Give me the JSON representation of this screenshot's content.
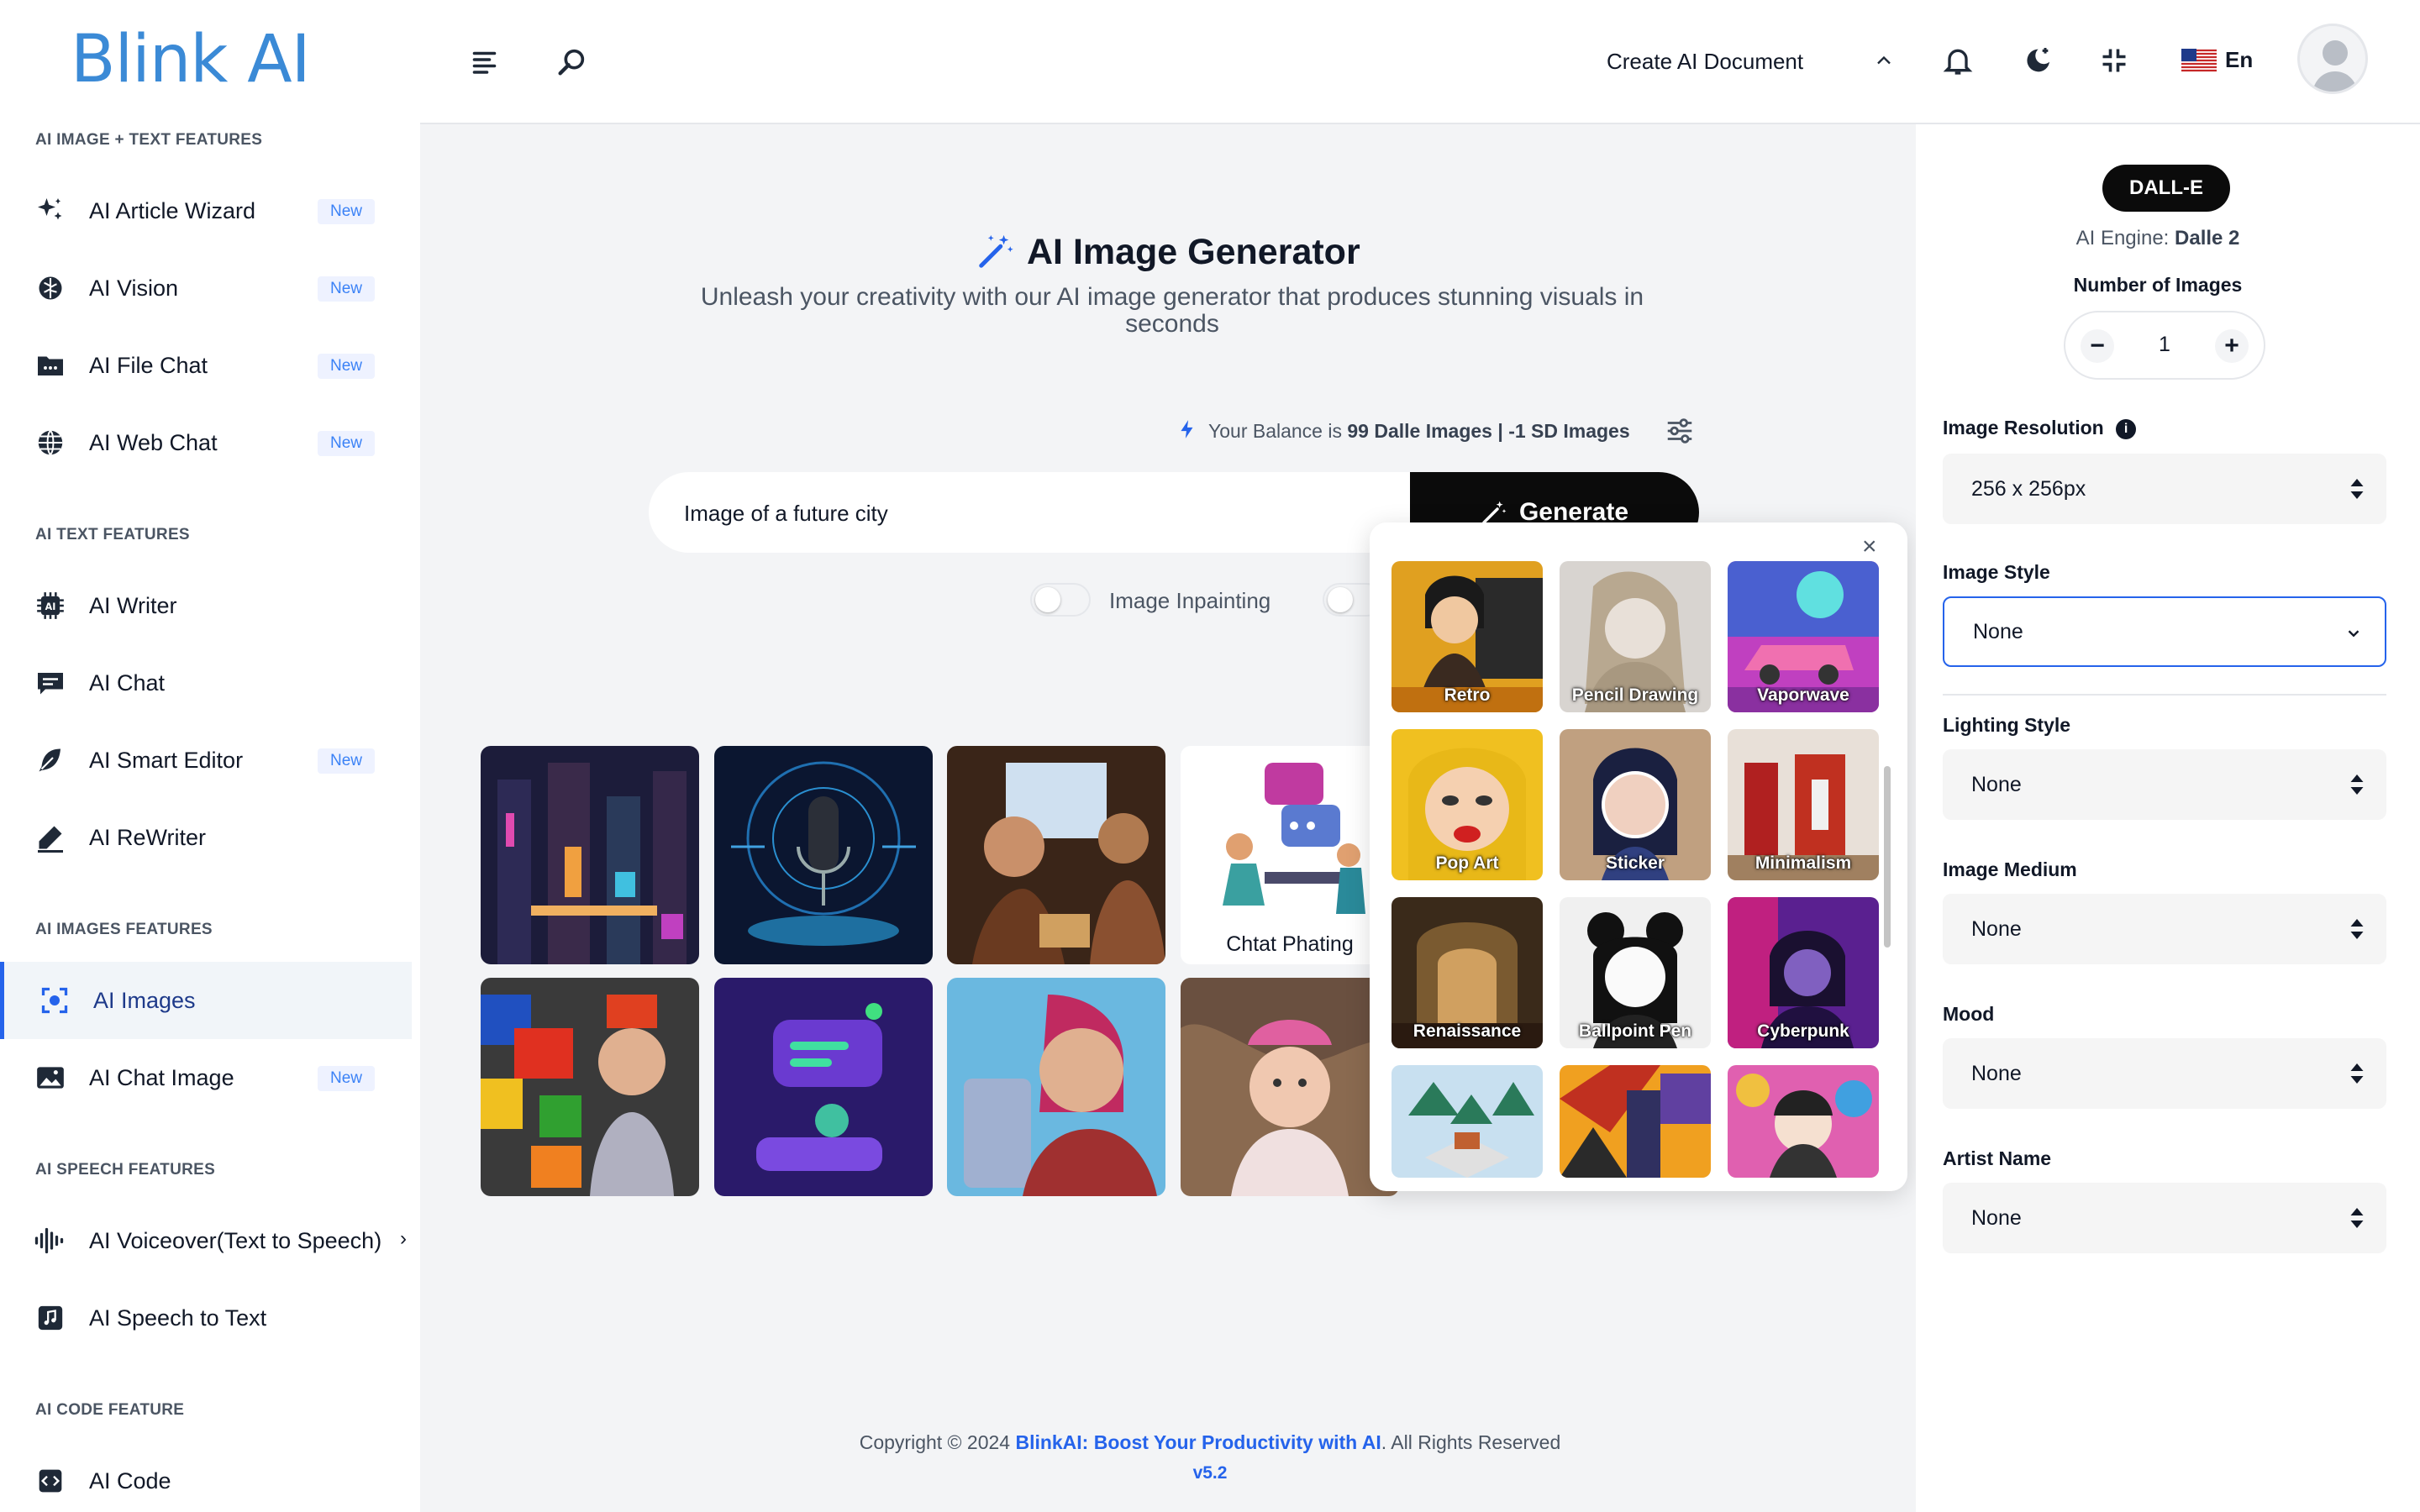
{
  "brand": {
    "logo": "Blink AI"
  },
  "sidebar": {
    "sections": [
      "AI IMAGE + TEXT FEATURES",
      "AI TEXT FEATURES",
      "AI IMAGES FEATURES",
      "AI SPEECH FEATURES",
      "AI CODE FEATURE"
    ],
    "items": [
      {
        "label": "AI Article Wizard",
        "badge": "New",
        "icon": "sparkles-icon"
      },
      {
        "label": "AI Vision",
        "badge": "New",
        "icon": "brain-icon"
      },
      {
        "label": "AI File Chat",
        "badge": "New",
        "icon": "folder-icon"
      },
      {
        "label": "AI Web Chat",
        "badge": "New",
        "icon": "globe-icon"
      },
      {
        "label": "AI Writer",
        "badge": "",
        "icon": "chip-icon"
      },
      {
        "label": "AI Chat",
        "badge": "",
        "icon": "chat-icon"
      },
      {
        "label": "AI Smart Editor",
        "badge": "New",
        "icon": "feather-icon"
      },
      {
        "label": "AI ReWriter",
        "badge": "",
        "icon": "pen-icon"
      },
      {
        "label": "AI Images",
        "badge": "",
        "icon": "scan-icon"
      },
      {
        "label": "AI Chat Image",
        "badge": "New",
        "icon": "image-icon"
      },
      {
        "label": "AI Voiceover(Text to Speech)",
        "badge": "",
        "icon": "waveform-icon"
      },
      {
        "label": "AI Speech to Text",
        "badge": "",
        "icon": "music-icon"
      },
      {
        "label": "AI Code",
        "badge": "",
        "icon": "code-icon"
      }
    ]
  },
  "header": {
    "create_doc": "Create AI Document",
    "language": "En"
  },
  "main": {
    "title": "AI Image Generator",
    "subtitle_line1": "Unleash your creativity with our AI image generator that produces stunning visuals in",
    "subtitle_line2": "seconds",
    "balance_prefix": "Your Balance is",
    "balance_value": "99 Dalle Images | -1 SD Images",
    "prompt_value": "Image of a future city",
    "generate_label": "Generate",
    "inpainting_label": "Image Inpainting",
    "gallery_caption": "Chtat Phating"
  },
  "styles_popover": {
    "items": [
      "Retro",
      "Pencil Drawing",
      "Vaporwave",
      "Pop Art",
      "Sticker",
      "Minimalism",
      "Renaissance",
      "Ballpoint Pen",
      "Cyberpunk"
    ]
  },
  "right_panel": {
    "engine_badge": "DALL-E",
    "engine_prefix": "AI Engine:",
    "engine_name": "Dalle 2",
    "num_images_label": "Number of Images",
    "num_images_value": "1",
    "resolution_label": "Image Resolution",
    "resolution_value": "256 x 256px",
    "style_label": "Image Style",
    "style_value": "None",
    "lighting_label": "Lighting Style",
    "lighting_value": "None",
    "medium_label": "Image Medium",
    "medium_value": "None",
    "mood_label": "Mood",
    "mood_value": "None",
    "artist_label": "Artist Name",
    "artist_value": "None"
  },
  "footer": {
    "prefix": "Copyright © 2024",
    "brand": "BlinkAI: Boost Your Productivity with AI",
    "suffix": ". All Rights Reserved",
    "version": "v5.2"
  },
  "colors": {
    "accent": "#2563eb",
    "brand": "#3b8ad6"
  }
}
